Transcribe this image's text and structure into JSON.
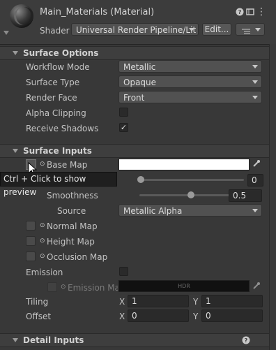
{
  "header": {
    "title": "Main_Materials (Material)",
    "shader_label": "Shader",
    "shader_value": "Universal Render Pipeline/Lit",
    "edit_button": "Edit...",
    "help_icon": "help-icon",
    "settings_icon": "gear-icon",
    "list_icon": "list-icon"
  },
  "surface_options": {
    "title": "Surface Options",
    "workflow_mode": {
      "label": "Workflow Mode",
      "value": "Metallic"
    },
    "surface_type": {
      "label": "Surface Type",
      "value": "Opaque"
    },
    "render_face": {
      "label": "Render Face",
      "value": "Front"
    },
    "alpha_clipping": {
      "label": "Alpha Clipping",
      "checked": ""
    },
    "receive_shadows": {
      "label": "Receive Shadows",
      "checked": "✓"
    }
  },
  "surface_inputs": {
    "title": "Surface Inputs",
    "base_map": {
      "label": "Base Map"
    },
    "metallic_value": "0",
    "smoothness": {
      "label": "Smoothness",
      "value": "0.5"
    },
    "source": {
      "label": "Source",
      "value": "Metallic Alpha"
    },
    "normal_map": {
      "label": "Normal Map"
    },
    "height_map": {
      "label": "Height Map"
    },
    "occlusion_map": {
      "label": "Occlusion Map"
    },
    "emission": {
      "label": "Emission"
    },
    "emission_map": {
      "label": "Emission Map",
      "hdr": "HDR"
    },
    "tiling": {
      "label": "Tiling",
      "x_label": "X",
      "x": "1",
      "y_label": "Y",
      "y": "1"
    },
    "offset": {
      "label": "Offset",
      "x_label": "X",
      "x": "0",
      "y_label": "Y",
      "y": "0"
    }
  },
  "detail_inputs": {
    "title": "Detail Inputs"
  },
  "tooltip": "Ctrl + Click to show preview",
  "colors": {
    "bg": "#383838",
    "field": "#2a2a2a",
    "accent": "#dcdcdc"
  }
}
